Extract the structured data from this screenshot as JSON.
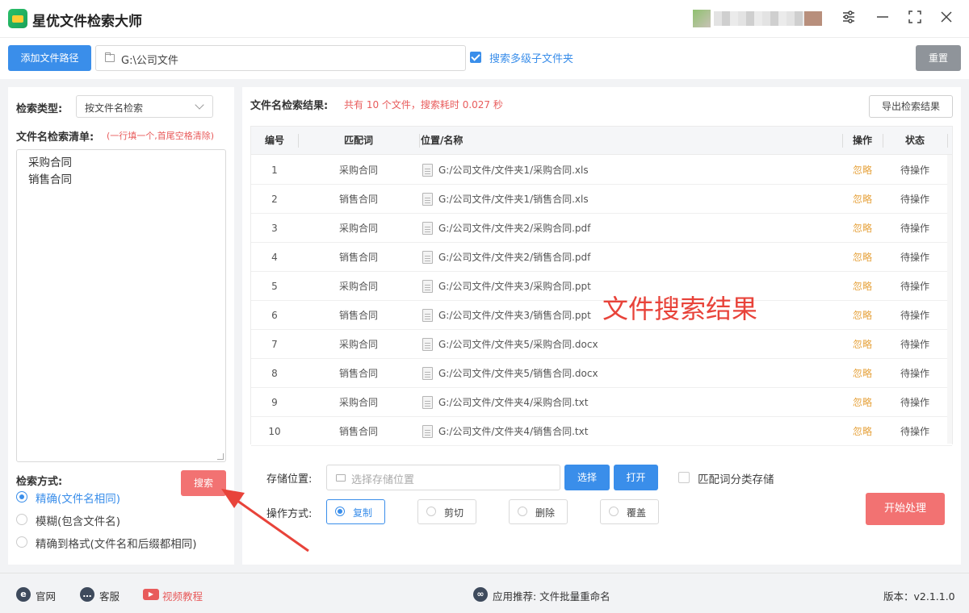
{
  "app": {
    "title": "星优文件检索大师"
  },
  "toolbar": {
    "add_path_label": "添加文件路径",
    "path_value": "G:\\公司文件",
    "subfolder_label": "搜索多级子文件夹",
    "subfolder_checked": true,
    "reset_label": "重置"
  },
  "left": {
    "search_type_label": "检索类型:",
    "search_type_value": "按文件名检索",
    "names_list_label": "文件名检索清单:",
    "names_list_hint": "(一行填一个,首尾空格清除)",
    "names": [
      "采购合同",
      "销售合同"
    ],
    "search_mode_label": "检索方式:",
    "search_button": "搜索",
    "modes": [
      {
        "label": "精确(文件名相同)",
        "selected": true
      },
      {
        "label": "模糊(包含文件名)",
        "selected": false
      },
      {
        "label": "精确到格式(文件名和后缀都相同)",
        "selected": false
      }
    ]
  },
  "results": {
    "title": "文件名检索结果:",
    "summary": "共有 10 个文件，搜索耗时 0.027 秒",
    "export_label": "导出检索结果",
    "columns": [
      "编号",
      "匹配词",
      "位置/名称",
      "操作",
      "状态"
    ],
    "rows": [
      {
        "no": "1",
        "keyword": "采购合同",
        "path": "G:/公司文件/文件夹1/采购合同.xls",
        "action": "忽略",
        "status": "待操作"
      },
      {
        "no": "2",
        "keyword": "销售合同",
        "path": "G:/公司文件/文件夹1/销售合同.xls",
        "action": "忽略",
        "status": "待操作"
      },
      {
        "no": "3",
        "keyword": "采购合同",
        "path": "G:/公司文件/文件夹2/采购合同.pdf",
        "action": "忽略",
        "status": "待操作"
      },
      {
        "no": "4",
        "keyword": "销售合同",
        "path": "G:/公司文件/文件夹2/销售合同.pdf",
        "action": "忽略",
        "status": "待操作"
      },
      {
        "no": "5",
        "keyword": "采购合同",
        "path": "G:/公司文件/文件夹3/采购合同.ppt",
        "action": "忽略",
        "status": "待操作"
      },
      {
        "no": "6",
        "keyword": "销售合同",
        "path": "G:/公司文件/文件夹3/销售合同.ppt",
        "action": "忽略",
        "status": "待操作"
      },
      {
        "no": "7",
        "keyword": "采购合同",
        "path": "G:/公司文件/文件夹5/采购合同.docx",
        "action": "忽略",
        "status": "待操作"
      },
      {
        "no": "8",
        "keyword": "销售合同",
        "path": "G:/公司文件/文件夹5/销售合同.docx",
        "action": "忽略",
        "status": "待操作"
      },
      {
        "no": "9",
        "keyword": "采购合同",
        "path": "G:/公司文件/文件夹4/采购合同.txt",
        "action": "忽略",
        "status": "待操作"
      },
      {
        "no": "10",
        "keyword": "销售合同",
        "path": "G:/公司文件/文件夹4/销售合同.txt",
        "action": "忽略",
        "status": "待操作"
      }
    ],
    "overlay_text": "文件搜索结果"
  },
  "storage": {
    "label": "存储位置:",
    "placeholder": "选择存储位置",
    "choose_label": "选择",
    "open_label": "打开",
    "classify_label": "匹配词分类存储",
    "classify_checked": false
  },
  "operation": {
    "label": "操作方式:",
    "options": [
      {
        "label": "复制",
        "selected": true
      },
      {
        "label": "剪切",
        "selected": false
      },
      {
        "label": "删除",
        "selected": false
      },
      {
        "label": "覆盖",
        "selected": false
      }
    ],
    "start_label": "开始处理"
  },
  "footer": {
    "website": "官网",
    "support": "客服",
    "video": "视频教程",
    "recommend": "应用推荐:  文件批量重命名",
    "version": "版本：v2.1.1.0"
  },
  "colors": {
    "primary": "#3a8eea",
    "danger": "#f27272",
    "warning": "#e6a23c",
    "reset_gray": "#8f949a",
    "annotation_red": "#e8433a"
  }
}
